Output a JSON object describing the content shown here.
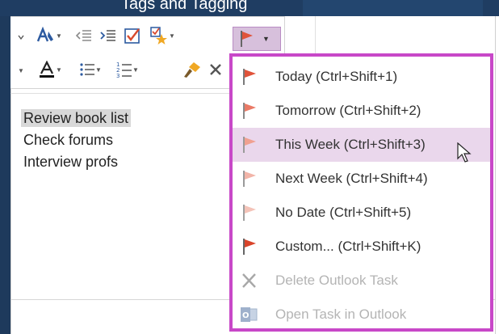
{
  "titlebar": {
    "title": "Tags and Tagging",
    "bg": "#1f3d62"
  },
  "toolbar": {
    "row1": [
      "styles-icon",
      "decrease-indent-icon",
      "increase-indent-icon",
      "todo-checkbox-icon",
      "find-tags-icon",
      "flag-icon"
    ],
    "row2": [
      "font-color-icon",
      "bullets-icon",
      "numbering-icon",
      "format-painter-icon",
      "clear-formatting-icon"
    ]
  },
  "note": {
    "items": [
      "Review book list",
      "Check forums",
      "Interview profs"
    ]
  },
  "menu": {
    "border_color": "#c848c8",
    "hover_color": "#ead7ec",
    "items": [
      {
        "label": "Today  (Ctrl+Shift+1)",
        "icon": "flag-today-icon",
        "color": "#e0533a"
      },
      {
        "label": "Tomorrow  (Ctrl+Shift+2)",
        "icon": "flag-tomorrow-icon",
        "color": "#ea7a66"
      },
      {
        "label": "This Week  (Ctrl+Shift+3)",
        "icon": "flag-this-week-icon",
        "color": "#f0a090"
      },
      {
        "label": "Next Week  (Ctrl+Shift+4)",
        "icon": "flag-next-week-icon",
        "color": "#f2b4a8"
      },
      {
        "label": "No Date  (Ctrl+Shift+5)",
        "icon": "flag-no-date-icon",
        "color": "#f4c3b8"
      },
      {
        "label": "Custom...  (Ctrl+Shift+K)",
        "icon": "flag-custom-icon",
        "color": "#d9442a"
      },
      {
        "label": "Delete Outlook Task",
        "icon": "delete-x-icon",
        "color": "#9a9a9a"
      },
      {
        "label": "Open Task in Outlook",
        "icon": "outlook-icon",
        "color": "#5a7fb0"
      }
    ]
  }
}
